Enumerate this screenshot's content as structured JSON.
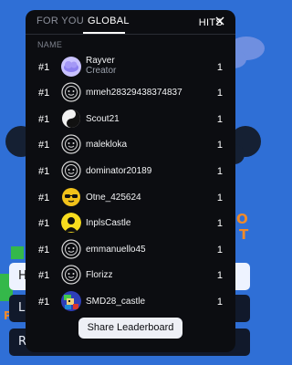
{
  "background": {
    "orange_text_lines": [
      "O",
      "T"
    ],
    "left_label": "P",
    "buttons": [
      "H",
      "L",
      "R"
    ]
  },
  "modal": {
    "tabs": [
      {
        "label": "FOR YOU",
        "active": false
      },
      {
        "label": "GLOBAL",
        "active": true
      }
    ],
    "columns": {
      "name": "NAME",
      "hits": "HITS"
    },
    "rows": [
      {
        "rank": "#1",
        "name": "Rayver",
        "subtitle": "Creator",
        "hits": "1",
        "avatar": "purple-cloud-avatar-icon"
      },
      {
        "rank": "#1",
        "name": "mmeh28329438374837",
        "hits": "1",
        "avatar": "default-face-avatar-icon"
      },
      {
        "rank": "#1",
        "name": "Scout21",
        "hits": "1",
        "avatar": "yin-yang-avatar-icon"
      },
      {
        "rank": "#1",
        "name": "malekloka",
        "hits": "1",
        "avatar": "default-face-avatar-icon"
      },
      {
        "rank": "#1",
        "name": "dominator20189",
        "hits": "1",
        "avatar": "default-face-avatar-icon"
      },
      {
        "rank": "#1",
        "name": "Otne_425624",
        "hits": "1",
        "avatar": "sunglasses-face-avatar-icon"
      },
      {
        "rank": "#1",
        "name": "InplsCastle",
        "hits": "1",
        "avatar": "silhouette-avatar-icon"
      },
      {
        "rank": "#1",
        "name": "emmanuello45",
        "hits": "1",
        "avatar": "default-face-avatar-icon"
      },
      {
        "rank": "#1",
        "name": "Florizz",
        "hits": "1",
        "avatar": "default-face-avatar-icon"
      },
      {
        "rank": "#1",
        "name": "SMD28_castle",
        "hits": "1",
        "avatar": "pixel-character-avatar-icon"
      }
    ],
    "share_label": "Share Leaderboard"
  },
  "colors": {
    "background_blue": "#2f6fd6",
    "modal_bg": "#0c0d11",
    "accent_orange": "#f08a2a",
    "creator_purple": "#9b8cf0"
  }
}
